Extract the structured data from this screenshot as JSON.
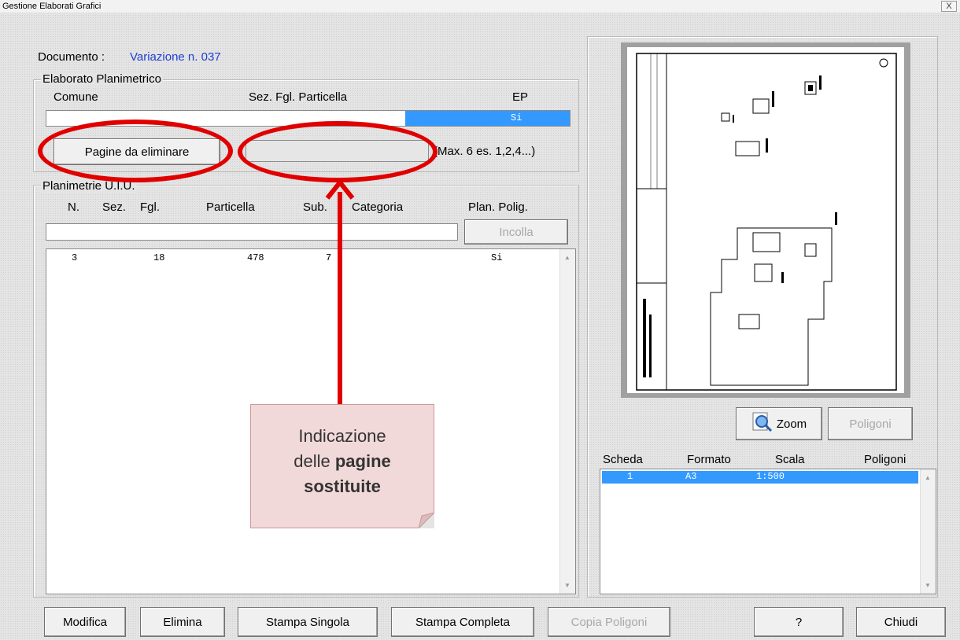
{
  "window": {
    "title": "Gestione Elaborati Grafici",
    "close": "X"
  },
  "documento": {
    "label": "Documento :",
    "value": "Variazione n. 037"
  },
  "ep_group": {
    "title": "Elaborato Planimetrico",
    "headers": {
      "comune": "Comune",
      "sez_fgl_part": "Sez. Fgl. Particella",
      "ep": "EP"
    },
    "row": {
      "ep": "Si"
    },
    "pages_button": "Pagine da eliminare",
    "pages_input": "",
    "max_hint": "(Max. 6 es. 1,2,4...)"
  },
  "planimetrie": {
    "title": "Planimetrie U.I.U.",
    "headers": [
      "N.",
      "Sez.",
      "Fgl.",
      "Particella",
      "Sub.",
      "Categoria",
      "Plan. Polig."
    ],
    "paste_input": "",
    "paste_button": "Incolla",
    "rows": [
      {
        "n": "3",
        "fgl": "18",
        "particella": "478",
        "sub": "7",
        "plan": "Si"
      }
    ]
  },
  "annotation": {
    "line1": "Indicazione",
    "line2_pre": "delle ",
    "line2_bold": "pagine",
    "line3_bold": "sostituite"
  },
  "preview": {
    "zoom_button": "Zoom",
    "poligoni_button": "Poligoni"
  },
  "schede": {
    "headers": [
      "Scheda",
      "Formato",
      "Scala",
      "Poligoni"
    ],
    "rows": [
      {
        "scheda": "1",
        "formato": "A3",
        "scala": "1:500"
      }
    ]
  },
  "bottom": {
    "modifica": "Modifica",
    "elimina": "Elimina",
    "stampa_singola": "Stampa Singola",
    "stampa_completa": "Stampa Completa",
    "copia_poligoni": "Copia Poligoni",
    "help": "?",
    "chiudi": "Chiudi"
  },
  "colors": {
    "accent_red": "#e00000",
    "selection": "#3399ff",
    "link_blue": "#1f3fd0"
  }
}
